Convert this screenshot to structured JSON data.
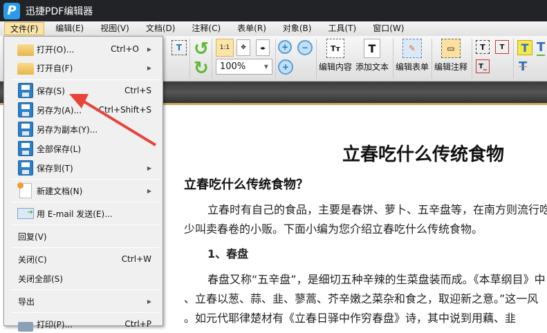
{
  "app": {
    "title": "迅捷PDF编辑器",
    "logo_letter": "P"
  },
  "menubar": [
    "文件(F)",
    "编辑(E)",
    "视图(V)",
    "文档(D)",
    "注释(C)",
    "表单(R)",
    "对象(B)",
    "工具(T)",
    "窗口(W)"
  ],
  "toolbar": {
    "zoom_value": "100%",
    "edit_content": "编辑内容",
    "add_text": "添加文本",
    "edit_form": "编辑表单",
    "edit_annotation": "编辑注释",
    "actual_size": "1:1"
  },
  "file_menu": [
    {
      "label": "打开(O)...",
      "shortcut": "Ctrl+O",
      "submenu": true
    },
    {
      "label": "打开自(F)",
      "shortcut": "",
      "submenu": true
    },
    {
      "label": "保存(S)",
      "shortcut": "Ctrl+S"
    },
    {
      "label": "另存为(A)...",
      "shortcut": "Ctrl+Shift+S"
    },
    {
      "label": "另存为副本(Y)...",
      "shortcut": ""
    },
    {
      "label": "全部保存(L)",
      "shortcut": ""
    },
    {
      "label": "保存到(T)",
      "shortcut": "",
      "submenu": true
    },
    {
      "label": "新建文档(N)",
      "shortcut": "",
      "submenu": true
    },
    {
      "label": "用 E-mail 发送(E)...",
      "shortcut": ""
    },
    {
      "label": "回复(V)",
      "shortcut": ""
    },
    {
      "label": "关闭(C)",
      "shortcut": "Ctrl+W"
    },
    {
      "label": "关闭全部(S)",
      "shortcut": ""
    },
    {
      "label": "导出",
      "shortcut": "",
      "submenu": true
    },
    {
      "label": "打印(P)...",
      "shortcut": "Ctrl+P"
    }
  ],
  "document": {
    "title": "立春吃什么传统食物",
    "heading": "立春吃什么传统食物？",
    "p1_l1": "立春时有自己的食品，主要是春饼、萝卜、五辛盘等，在南方则流行吃春卷，",
    "p1_l2": "少叫卖春卷的小贩。下面小编为您介绍立春吃什么传统食物。",
    "sub1": "1、春盘",
    "p2_l1": "春盘又称“五辛盘”，是细切五种辛辣的生菜盘装而成。《本草纲目》中",
    "p2_l2": "、立春以葱、蒜、韭、蓼蒿、芥辛嫩之菜杂和食之，取迎新之意。”这一风",
    "p2_l3": "。如元代耶律楚材有《立春日驿中作穷春盘》诗，其中说到用藕、韭"
  },
  "colors": {
    "arrow": "#e8433a",
    "accent": "#2a9be8"
  }
}
